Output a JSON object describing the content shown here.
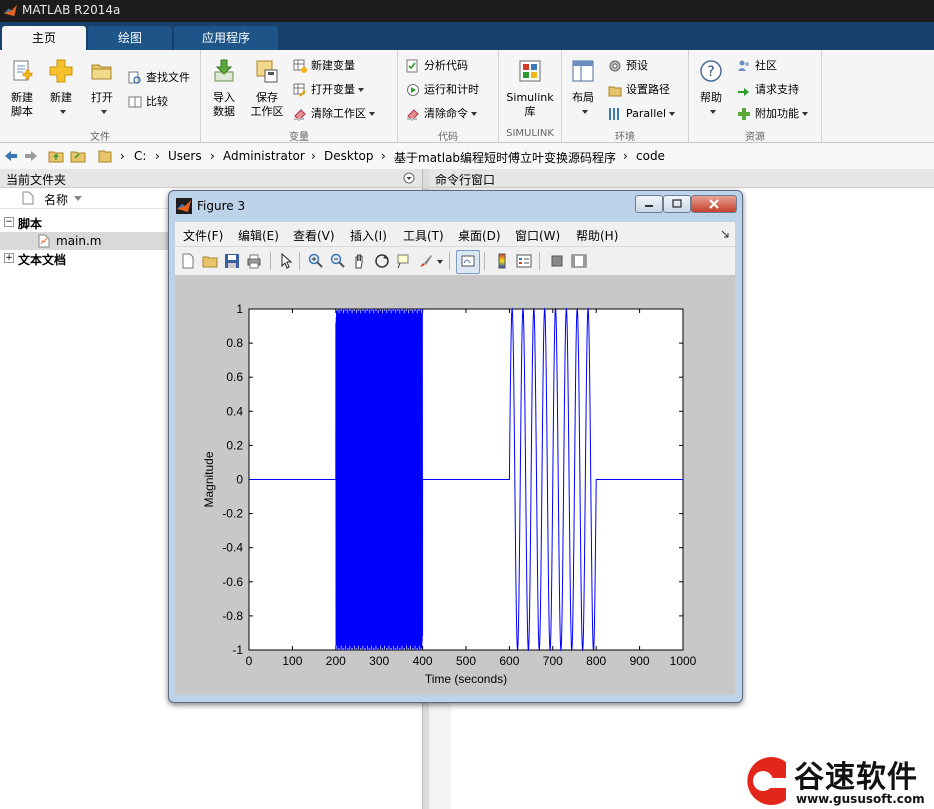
{
  "app": {
    "title": "MATLAB R2014a"
  },
  "tabs": [
    {
      "label": "主页",
      "active": true
    },
    {
      "label": "绘图",
      "active": false
    },
    {
      "label": "应用程序",
      "active": false
    }
  ],
  "ribbon": {
    "file": {
      "label": "文件",
      "new_script": "新建\n脚本",
      "new": "新建",
      "open": "打开",
      "find_files": "查找文件",
      "compare": "比较"
    },
    "variable": {
      "label": "变量",
      "import_data": "导入\n数据",
      "save_workspace": "保存\n工作区",
      "new_variable": "新建变量",
      "open_variable": "打开变量",
      "clear_workspace": "清除工作区"
    },
    "code": {
      "label": "代码",
      "analyze_code": "分析代码",
      "run_and_time": "运行和计时",
      "clear_commands": "清除命令"
    },
    "simulink": {
      "label": "SIMULINK",
      "library": "Simulink\n库"
    },
    "environment": {
      "label": "环境",
      "layout": "布局",
      "preferences": "预设",
      "set_path": "设置路径",
      "parallel": "Parallel"
    },
    "resources": {
      "label": "资源",
      "help": "帮助",
      "community": "社区",
      "request_support": "请求支持",
      "addons": "附加功能"
    }
  },
  "address": {
    "crumbs": [
      "C:",
      "Users",
      "Administrator",
      "Desktop",
      "基于matlab编程短时傅立叶变换源码程序",
      "code"
    ]
  },
  "current_folder": {
    "title": "当前文件夹",
    "name_col": "名称",
    "groups": [
      {
        "label": "脚本",
        "expanded": true,
        "items": [
          "main.m"
        ]
      },
      {
        "label": "文本文档",
        "expanded": false,
        "items": []
      }
    ]
  },
  "command_window": {
    "title": "命令行窗口"
  },
  "figure": {
    "title": "Figure 3",
    "menu": [
      "文件(F)",
      "编辑(E)",
      "查看(V)",
      "插入(I)",
      "工具(T)",
      "桌面(D)",
      "窗口(W)",
      "帮助(H)"
    ]
  },
  "chart_data": {
    "type": "line",
    "xlabel": "Time (seconds)",
    "ylabel": "Magnitude",
    "xlim": [
      0,
      1000
    ],
    "ylim": [
      -1,
      1
    ],
    "xticks": [
      "0",
      "100",
      "200",
      "300",
      "400",
      "500",
      "600",
      "700",
      "800",
      "900",
      "1000"
    ],
    "yticks": [
      "1",
      "0.8",
      "0.6",
      "0.4",
      "0.2",
      "0",
      "-0.2",
      "-0.4",
      "-0.6",
      "-0.8",
      "-1"
    ],
    "line_color": "#0000ff",
    "segments": [
      {
        "x_start": 0,
        "x_end": 200,
        "signal": "zero"
      },
      {
        "x_start": 200,
        "x_end": 400,
        "signal": "high-frequency sine"
      },
      {
        "x_start": 400,
        "x_end": 600,
        "signal": "zero"
      },
      {
        "x_start": 600,
        "x_end": 800,
        "signal": "low-frequency sine"
      },
      {
        "x_start": 800,
        "x_end": 1000,
        "signal": "zero"
      }
    ]
  },
  "watermark": {
    "brand": "谷速软件",
    "url": "www.gususoft.com"
  }
}
